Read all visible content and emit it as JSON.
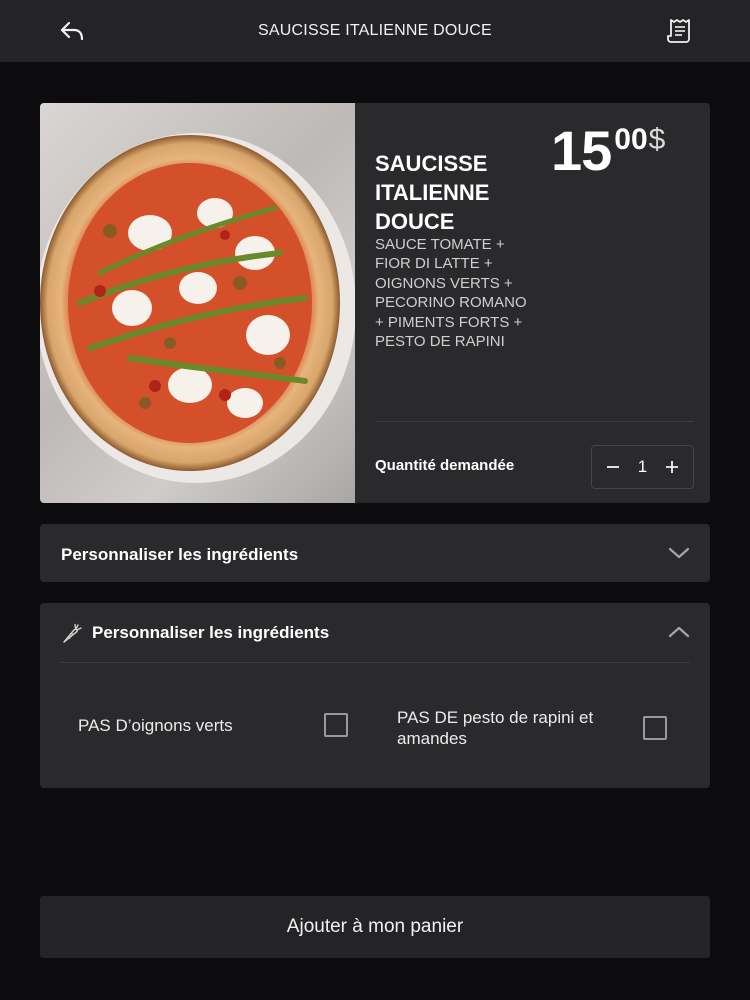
{
  "header": {
    "title": "SAUCISSE ITALIENNE DOUCE",
    "back_icon": "back-arrow-icon",
    "receipt_icon": "receipt-icon"
  },
  "product": {
    "name": "SAUCISSE ITALIENNE DOUCE",
    "description": "SAUCE TOMATE + FIOR DI LATTE + OIGNONS VERTS + PECORINO ROMANO + PIMENTS FORTS + PESTO DE RAPINI",
    "price_whole": "15",
    "price_cents": "00",
    "currency": "$",
    "quantity_label": "Quantité demandée",
    "quantity": "1",
    "minus_icon": "minus-icon",
    "plus_icon": "plus-icon"
  },
  "accordions": [
    {
      "title": "Personnaliser les ingrédients",
      "state": "collapsed",
      "icon": "chevron-down-icon"
    },
    {
      "title": "Personnaliser les ingrédients",
      "state": "expanded",
      "leading_icon": "carrot-icon",
      "icon": "chevron-up-icon",
      "options": [
        {
          "label": "PAS D’oignons verts",
          "checked": false
        },
        {
          "label": "PAS DE pesto de rapini et amandes",
          "checked": false
        }
      ]
    }
  ],
  "cta": {
    "label": "Ajouter à mon panier"
  },
  "colors": {
    "background": "#0c0b0d",
    "surface": "#2a292c",
    "bar": "#242326",
    "text": "#ffffff",
    "muted_text": "#cfcfcf"
  }
}
